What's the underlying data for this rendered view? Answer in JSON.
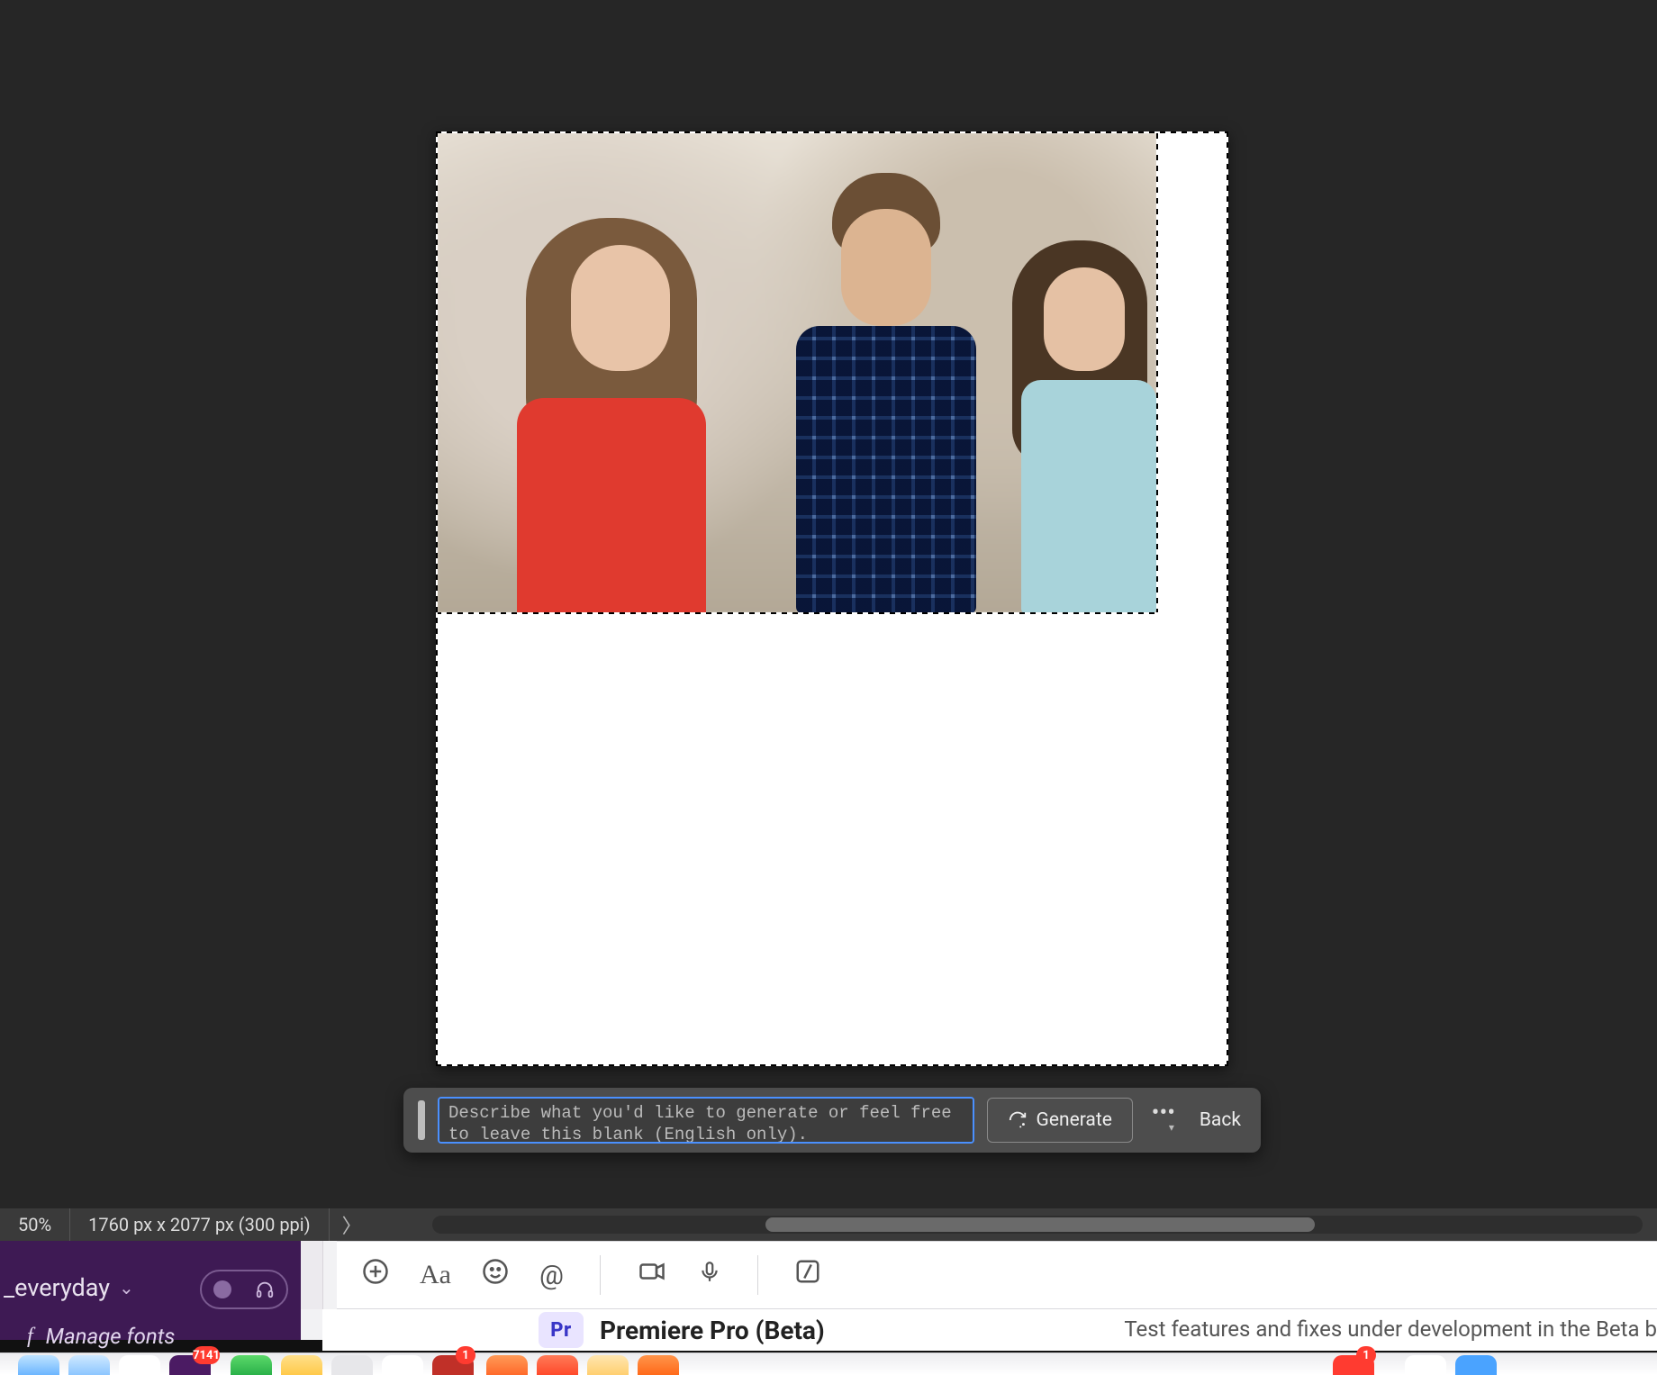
{
  "editor": {
    "zoom_label": "50%",
    "dimensions_label": "1760 px x 2077 px (300 ppi)"
  },
  "generate_bar": {
    "prompt_value": "",
    "prompt_placeholder": "Describe what you'd like to generate or feel free to leave this blank (English only).",
    "generate_label": "Generate",
    "back_label": "Back"
  },
  "background_panel": {
    "channel_name": "_everyday",
    "manage_fonts_label": "Manage fonts"
  },
  "creative_cloud": {
    "app_badge": "Pr",
    "app_title": "Premiere Pro (Beta)",
    "app_desc_fragment": "Test features and fixes under development in the Beta b"
  },
  "composer_icons": {
    "plus": "+",
    "format": "Aa",
    "emoji": "☺",
    "mention": "@",
    "video": "video",
    "audio": "mic",
    "slash": "slash"
  },
  "dock": {
    "badge_count": "7141",
    "badge_small": "1"
  }
}
